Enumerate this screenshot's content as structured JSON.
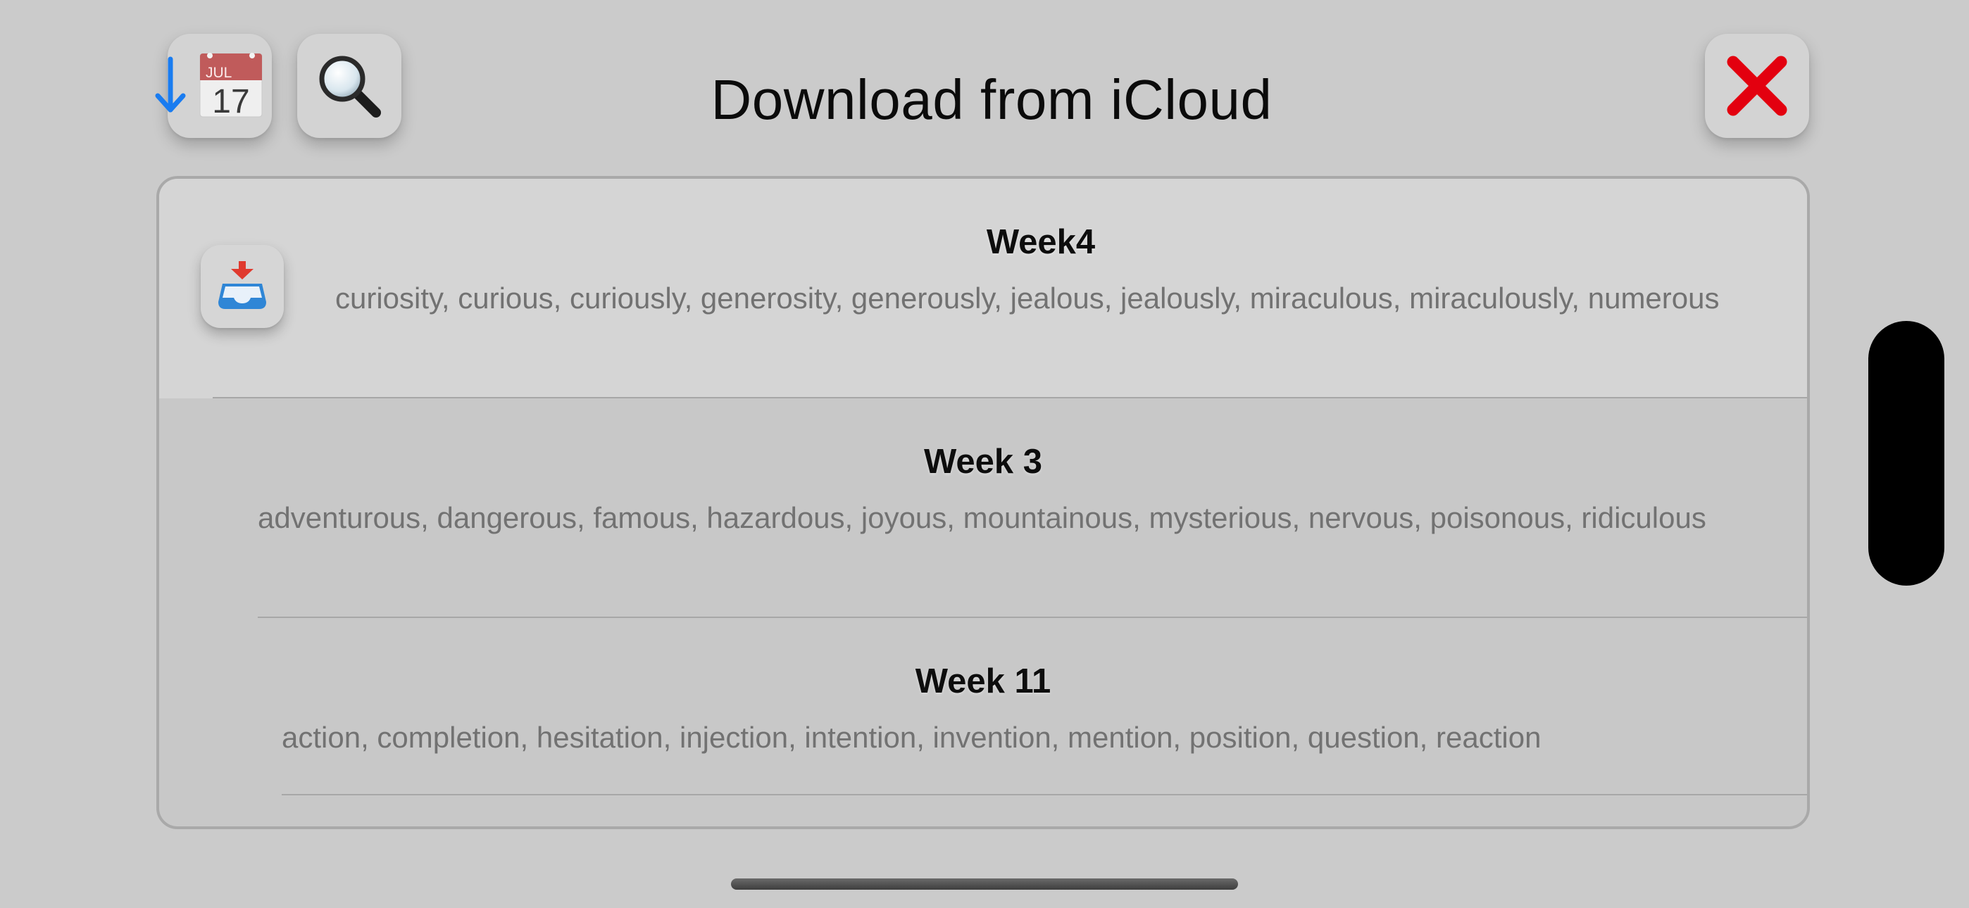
{
  "header": {
    "title": "Download from iCloud",
    "buttons": {
      "download_calendar": {
        "icon": "download-calendar-icon",
        "arrow_color": "#1a7cf0",
        "calendar_month": "JUL",
        "calendar_day": "17"
      },
      "search": {
        "icon": "magnifying-glass-icon"
      },
      "close": {
        "icon": "close-x-icon",
        "color": "#e3000f"
      }
    }
  },
  "list": {
    "rows": [
      {
        "title": "Week4",
        "words": "curiosity, curious, curiously, generosity, generously, jealous, jealously, miraculous, miraculously, numerous",
        "action_icon": "inbox-download-icon"
      },
      {
        "title": "Week 3",
        "words": "adventurous, dangerous, famous, hazardous, joyous, mountainous, mysterious, nervous, poisonous, ridiculous"
      },
      {
        "title": "Week 11",
        "words": "action, completion, hesitation, injection, intention, invention, mention, position, question, reaction"
      }
    ]
  },
  "colors": {
    "background": "#cbcbcb",
    "highlight_row": "#d5d5d5",
    "secondary_text": "#727272",
    "accent_blue": "#1a7cf0",
    "close_red": "#e3000f"
  }
}
